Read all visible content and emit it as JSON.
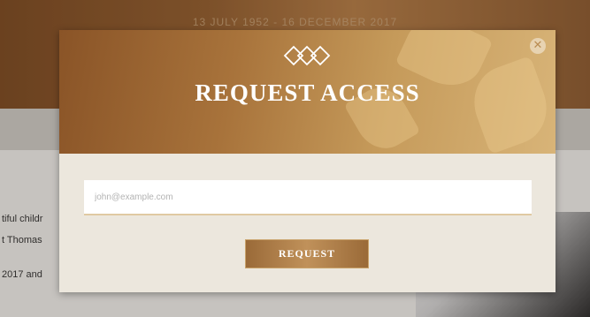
{
  "background": {
    "dates": "13 JULY 1952 - 16 DECEMBER 2017",
    "text_lines": [
      "tiful childr",
      "t Thomas",
      "2017 and"
    ]
  },
  "modal": {
    "title": "REQUEST ACCESS",
    "close_icon": "close-icon",
    "logo_icon": "diamond-lattice-logo",
    "email_field": {
      "placeholder": "john@example.com",
      "value": ""
    },
    "submit_label": "REQUEST"
  },
  "colors": {
    "header_brown": "#8a5427",
    "header_gold": "#d8b478",
    "body_cream": "#ece7dd",
    "button_bronze": "#a8733b"
  }
}
